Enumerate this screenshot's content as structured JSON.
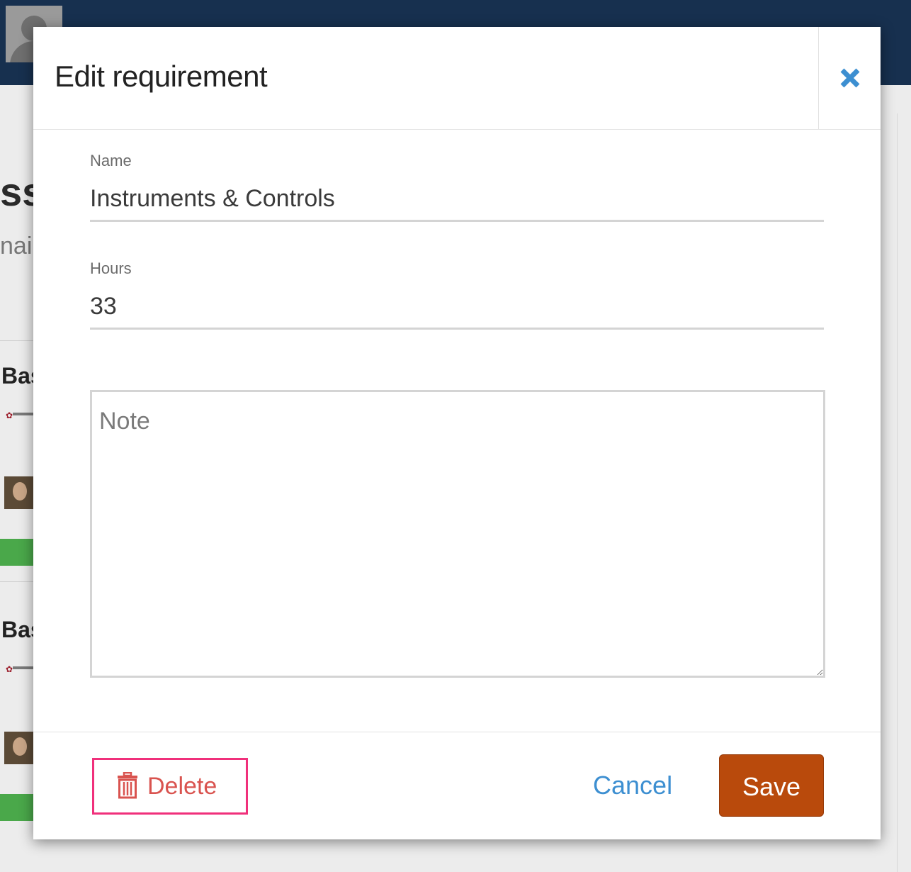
{
  "background": {
    "heading_fragment": "ssc",
    "sub_fragment": "nair",
    "card_title_fragment": "Bas",
    "colors": {
      "topbar": "#17304f",
      "progress": "#4aa84a"
    }
  },
  "modal": {
    "title": "Edit requirement",
    "close_icon": "close-icon",
    "fields": {
      "name": {
        "label": "Name",
        "value": "Instruments & Controls"
      },
      "hours": {
        "label": "Hours",
        "value": "33"
      },
      "note": {
        "placeholder": "Note",
        "value": ""
      }
    },
    "footer": {
      "delete_label": "Delete",
      "delete_icon": "trash-icon",
      "cancel_label": "Cancel",
      "save_label": "Save"
    },
    "colors": {
      "close": "#3d8fd1",
      "delete": "#d9534f",
      "highlight": "#f0307b",
      "cancel": "#3d8fd1",
      "save": "#b94a0c"
    }
  }
}
